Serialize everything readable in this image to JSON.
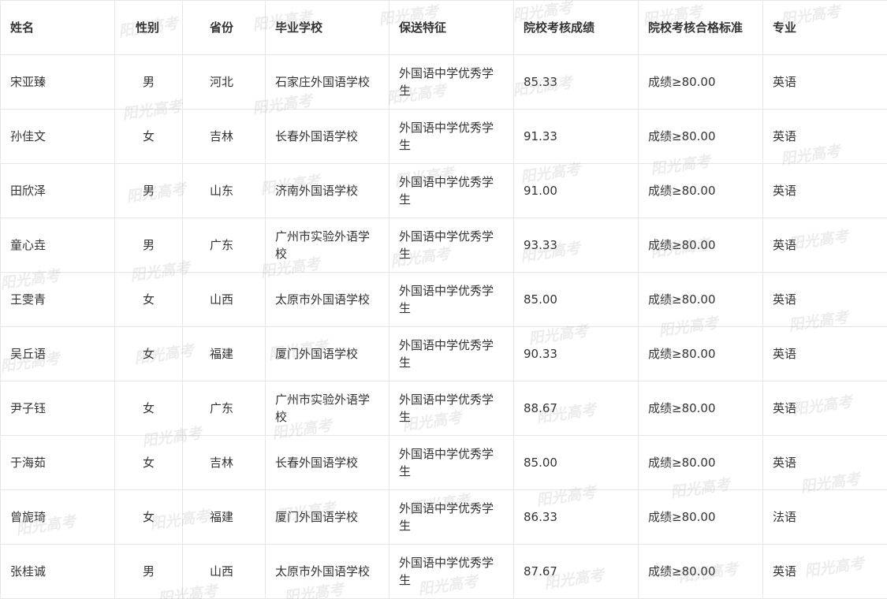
{
  "headers": [
    "姓名",
    "性别",
    "省份",
    "毕业学校",
    "保送特征",
    "院校考核成绩",
    "院校考核合格标准",
    "专业"
  ],
  "rows": [
    [
      "宋亚臻",
      "男",
      "河北",
      "石家庄外国语学校",
      "外国语中学优秀学生",
      "85.33",
      "成绩≥80.00",
      "英语"
    ],
    [
      "孙佳文",
      "女",
      "吉林",
      "长春外国语学校",
      "外国语中学优秀学生",
      "91.33",
      "成绩≥80.00",
      "英语"
    ],
    [
      "田欣泽",
      "男",
      "山东",
      "济南外国语学校",
      "外国语中学优秀学生",
      "91.00",
      "成绩≥80.00",
      "英语"
    ],
    [
      "童心垚",
      "男",
      "广东",
      "广州市实验外语学校",
      "外国语中学优秀学生",
      "93.33",
      "成绩≥80.00",
      "英语"
    ],
    [
      "王雯青",
      "女",
      "山西",
      "太原市外国语学校",
      "外国语中学优秀学生",
      "85.00",
      "成绩≥80.00",
      "英语"
    ],
    [
      "吴丘语",
      "女",
      "福建",
      "厦门外国语学校",
      "外国语中学优秀学生",
      "90.33",
      "成绩≥80.00",
      "英语"
    ],
    [
      "尹子钰",
      "女",
      "广东",
      "广州市实验外语学校",
      "外国语中学优秀学生",
      "88.67",
      "成绩≥80.00",
      "英语"
    ],
    [
      "于海茹",
      "女",
      "吉林",
      "长春外国语学校",
      "外国语中学优秀学生",
      "85.00",
      "成绩≥80.00",
      "英语"
    ],
    [
      "曾旎琦",
      "女",
      "福建",
      "厦门外国语学校",
      "外国语中学优秀学生",
      "86.33",
      "成绩≥80.00",
      "法语"
    ],
    [
      "张桂诚",
      "男",
      "山西",
      "太原市外国语学校",
      "外国语中学优秀学生",
      "87.67",
      "成绩≥80.00",
      "英语"
    ]
  ],
  "watermark": "阳光高考"
}
